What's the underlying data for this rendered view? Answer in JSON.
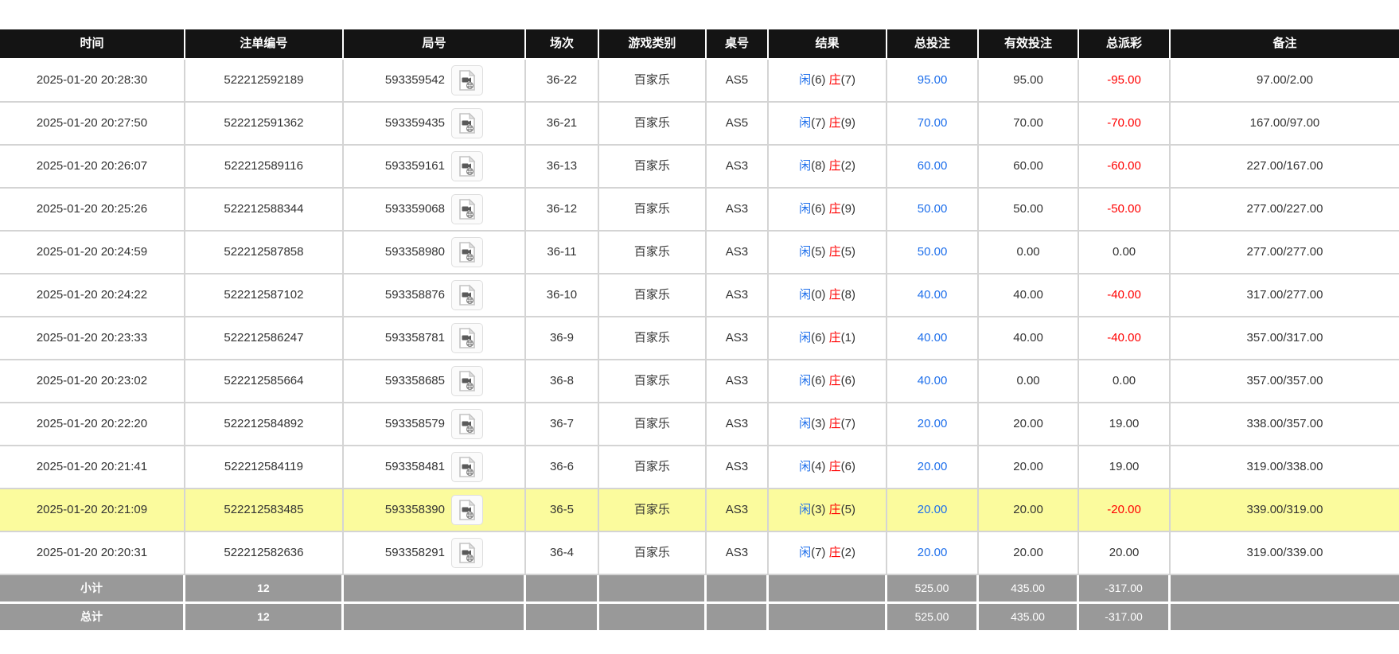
{
  "colors": {
    "header_bg": "#141414",
    "row_border": "#d4d4d4",
    "highlight_row_bg": "#fbfb9d",
    "summary_bg": "#999999",
    "bet_blue": "#1e6feb",
    "loss_red": "#ff0000",
    "text": "#333333"
  },
  "table": {
    "headers": [
      "时间",
      "注单编号",
      "局号",
      "场次",
      "游戏类别",
      "桌号",
      "结果",
      "总投注",
      "有效投注",
      "总派彩",
      "备注"
    ],
    "result_labels": {
      "player": "闲",
      "banker": "庄"
    },
    "rows": [
      {
        "time": "2025-01-20 20:28:30",
        "bet_no": "522212592189",
        "round_no": "593359542",
        "session": "36-22",
        "game": "百家乐",
        "table_no": "AS5",
        "player_score": "(6)",
        "banker_score": "(7)",
        "total_bet": "95.00",
        "valid_bet": "95.00",
        "payout": "-95.00",
        "remark": "97.00/2.00",
        "highlight": false
      },
      {
        "time": "2025-01-20 20:27:50",
        "bet_no": "522212591362",
        "round_no": "593359435",
        "session": "36-21",
        "game": "百家乐",
        "table_no": "AS5",
        "player_score": "(7)",
        "banker_score": "(9)",
        "total_bet": "70.00",
        "valid_bet": "70.00",
        "payout": "-70.00",
        "remark": "167.00/97.00",
        "highlight": false
      },
      {
        "time": "2025-01-20 20:26:07",
        "bet_no": "522212589116",
        "round_no": "593359161",
        "session": "36-13",
        "game": "百家乐",
        "table_no": "AS3",
        "player_score": "(8)",
        "banker_score": "(2)",
        "total_bet": "60.00",
        "valid_bet": "60.00",
        "payout": "-60.00",
        "remark": "227.00/167.00",
        "highlight": false
      },
      {
        "time": "2025-01-20 20:25:26",
        "bet_no": "522212588344",
        "round_no": "593359068",
        "session": "36-12",
        "game": "百家乐",
        "table_no": "AS3",
        "player_score": "(6)",
        "banker_score": "(9)",
        "total_bet": "50.00",
        "valid_bet": "50.00",
        "payout": "-50.00",
        "remark": "277.00/227.00",
        "highlight": false
      },
      {
        "time": "2025-01-20 20:24:59",
        "bet_no": "522212587858",
        "round_no": "593358980",
        "session": "36-11",
        "game": "百家乐",
        "table_no": "AS3",
        "player_score": "(5)",
        "banker_score": "(5)",
        "total_bet": "50.00",
        "valid_bet": "0.00",
        "payout": "0.00",
        "remark": "277.00/277.00",
        "highlight": false
      },
      {
        "time": "2025-01-20 20:24:22",
        "bet_no": "522212587102",
        "round_no": "593358876",
        "session": "36-10",
        "game": "百家乐",
        "table_no": "AS3",
        "player_score": "(0)",
        "banker_score": "(8)",
        "total_bet": "40.00",
        "valid_bet": "40.00",
        "payout": "-40.00",
        "remark": "317.00/277.00",
        "highlight": false
      },
      {
        "time": "2025-01-20 20:23:33",
        "bet_no": "522212586247",
        "round_no": "593358781",
        "session": "36-9",
        "game": "百家乐",
        "table_no": "AS3",
        "player_score": "(6)",
        "banker_score": "(1)",
        "total_bet": "40.00",
        "valid_bet": "40.00",
        "payout": "-40.00",
        "remark": "357.00/317.00",
        "highlight": false
      },
      {
        "time": "2025-01-20 20:23:02",
        "bet_no": "522212585664",
        "round_no": "593358685",
        "session": "36-8",
        "game": "百家乐",
        "table_no": "AS3",
        "player_score": "(6)",
        "banker_score": "(6)",
        "total_bet": "40.00",
        "valid_bet": "0.00",
        "payout": "0.00",
        "remark": "357.00/357.00",
        "highlight": false
      },
      {
        "time": "2025-01-20 20:22:20",
        "bet_no": "522212584892",
        "round_no": "593358579",
        "session": "36-7",
        "game": "百家乐",
        "table_no": "AS3",
        "player_score": "(3)",
        "banker_score": "(7)",
        "total_bet": "20.00",
        "valid_bet": "20.00",
        "payout": "19.00",
        "remark": "338.00/357.00",
        "highlight": false
      },
      {
        "time": "2025-01-20 20:21:41",
        "bet_no": "522212584119",
        "round_no": "593358481",
        "session": "36-6",
        "game": "百家乐",
        "table_no": "AS3",
        "player_score": "(4)",
        "banker_score": "(6)",
        "total_bet": "20.00",
        "valid_bet": "20.00",
        "payout": "19.00",
        "remark": "319.00/338.00",
        "highlight": false
      },
      {
        "time": "2025-01-20 20:21:09",
        "bet_no": "522212583485",
        "round_no": "593358390",
        "session": "36-5",
        "game": "百家乐",
        "table_no": "AS3",
        "player_score": "(3)",
        "banker_score": "(5)",
        "total_bet": "20.00",
        "valid_bet": "20.00",
        "payout": "-20.00",
        "remark": "339.00/319.00",
        "highlight": true
      },
      {
        "time": "2025-01-20 20:20:31",
        "bet_no": "522212582636",
        "round_no": "593358291",
        "session": "36-4",
        "game": "百家乐",
        "table_no": "AS3",
        "player_score": "(7)",
        "banker_score": "(2)",
        "total_bet": "20.00",
        "valid_bet": "20.00",
        "payout": "20.00",
        "remark": "319.00/339.00",
        "highlight": false
      }
    ],
    "summary": [
      {
        "label": "小计",
        "count": "12",
        "total_bet": "525.00",
        "valid_bet": "435.00",
        "payout": "-317.00"
      },
      {
        "label": "总计",
        "count": "12",
        "total_bet": "525.00",
        "valid_bet": "435.00",
        "payout": "-317.00"
      }
    ]
  }
}
